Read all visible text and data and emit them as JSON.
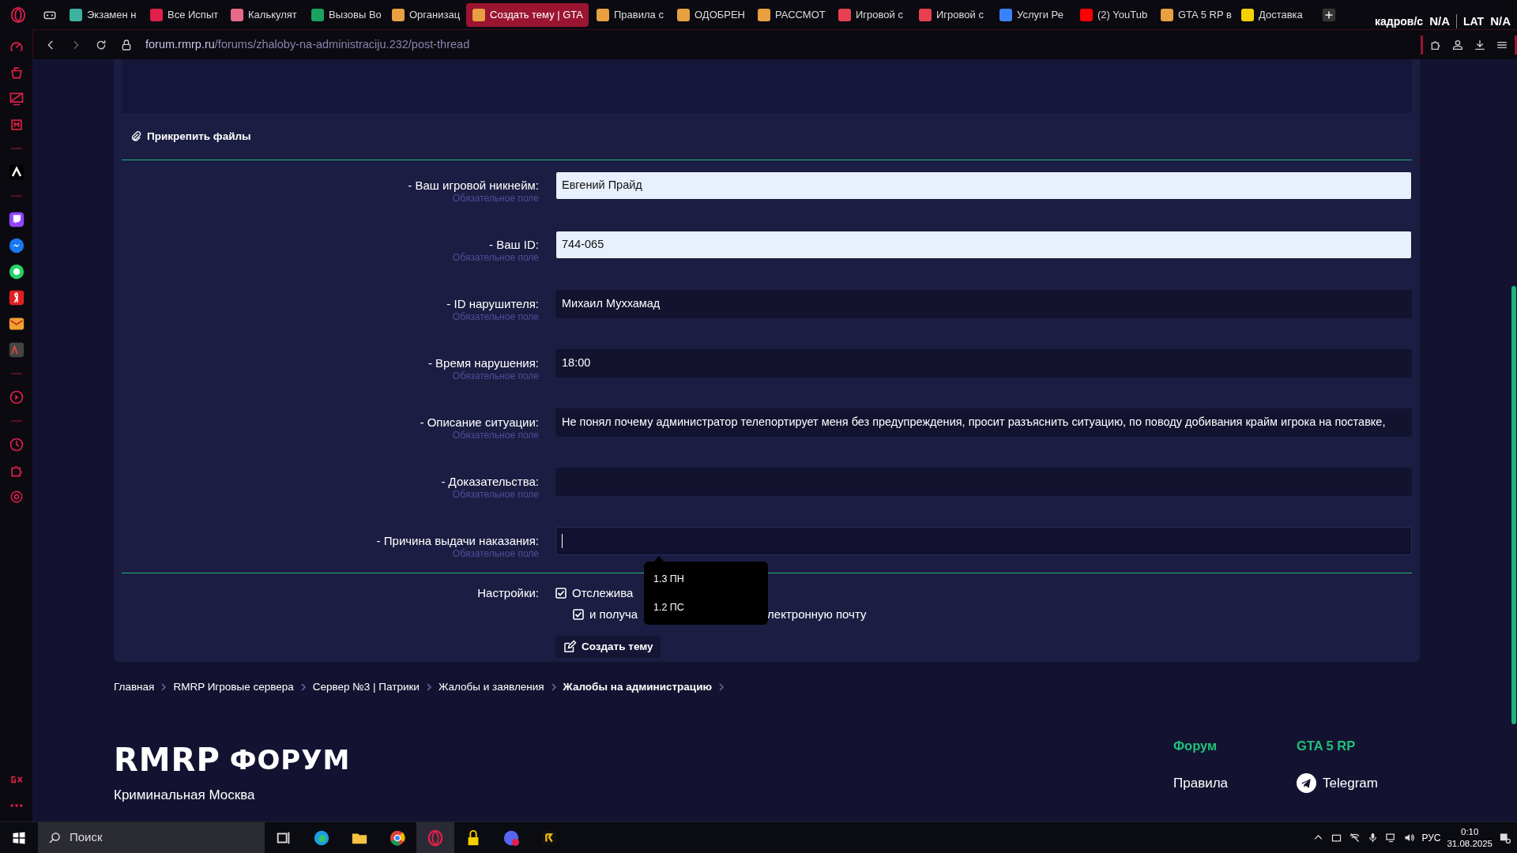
{
  "tabs": [
    {
      "label": "Экзамен н",
      "selected": false,
      "color": "#3bb3a0"
    },
    {
      "label": "Все Испыт",
      "selected": false,
      "color": "#e0204a"
    },
    {
      "label": "Калькулят",
      "selected": false,
      "color": "#e86a8a"
    },
    {
      "label": "Вызовы Во",
      "selected": false,
      "color": "#1aa260"
    },
    {
      "label": "Организац",
      "selected": false,
      "color": "#e8a040"
    },
    {
      "label": "Создать тему | GTA",
      "selected": true,
      "color": "#e8a040"
    },
    {
      "label": "Правила с",
      "selected": false,
      "color": "#e8a040"
    },
    {
      "label": "ОДОБРЕН",
      "selected": false,
      "color": "#e8a040"
    },
    {
      "label": "РАССМОТ",
      "selected": false,
      "color": "#e8a040"
    },
    {
      "label": "Игровой с",
      "selected": false,
      "color": "#e84050"
    },
    {
      "label": "Игровой с",
      "selected": false,
      "color": "#e84050"
    },
    {
      "label": "Услуги Ре",
      "selected": false,
      "color": "#3b82f6"
    },
    {
      "label": "(2) YouTub",
      "selected": false,
      "color": "#ff0000"
    },
    {
      "label": "GTA 5 RP в",
      "selected": false,
      "color": "#e8a040"
    },
    {
      "label": "Доставка",
      "selected": false,
      "color": "#f5d000"
    }
  ],
  "overlay_stats": [
    {
      "label": "кадров/с",
      "value": "N/A"
    },
    {
      "label": "LAT",
      "value": "N/A"
    }
  ],
  "address_bar": {
    "host": "forum.rmrp.ru",
    "path": "/forums/zhaloby-na-administraciju.232/post-thread"
  },
  "attach_button": "Прикрепить файлы",
  "fields": [
    {
      "label": "- Ваш игровой никнейм:",
      "hint": "Обязательное поле",
      "value": "Евгений Прайд",
      "autofilled": true,
      "focused": false
    },
    {
      "label": "- Ваш ID:",
      "hint": "Обязательное поле",
      "value": "744-065",
      "autofilled": true,
      "focused": false
    },
    {
      "label": "- ID нарушителя:",
      "hint": "Обязательное поле",
      "value": "Михаил Муххамад",
      "autofilled": false,
      "focused": false
    },
    {
      "label": "- Время нарушения:",
      "hint": "Обязательное поле",
      "value": "18:00",
      "autofilled": false,
      "focused": false
    },
    {
      "label": "- Описание ситуации:",
      "hint": "Обязательное поле",
      "value": "Не понял почему администратор телепортирует меня без предупреждения, просит разъяснить ситуацию, по поводу добивания крайм игрока на поставке,",
      "autofilled": false,
      "focused": false
    },
    {
      "label": "- Доказательства:",
      "hint": "Обязательное поле",
      "autofilled": false,
      "focused": false
    },
    {
      "label": "- Причина выдачи наказания:",
      "hint": "Обязательное поле",
      "autofilled": false,
      "focused": true
    }
  ],
  "autocomplete": [
    "1.3 ПН",
    "1.2 ПС"
  ],
  "settings": {
    "label": "Настройки:",
    "options": [
      {
        "label": "Отслежива",
        "checked": true
      },
      {
        "label": "и получа",
        "label_end": "лектронную почту",
        "checked": true
      }
    ]
  },
  "submit_button": "Создать тему",
  "breadcrumbs": [
    {
      "label": "Главная",
      "current": false
    },
    {
      "label": "RMRP Игровые сервера",
      "current": false
    },
    {
      "label": "Сервер №3 | Патрики",
      "current": false
    },
    {
      "label": "Жалобы и заявления",
      "current": false
    },
    {
      "label": "Жалобы на администрацию",
      "current": true
    }
  ],
  "footer": {
    "logo_left": "RMRP",
    "logo_right": "ФОРУМ",
    "tagline": "Криминальная Москва",
    "columns": [
      {
        "heading": "Форум",
        "items": [
          {
            "label": "Правила",
            "kind": "text"
          }
        ]
      },
      {
        "heading": "GTA 5 RP",
        "items": [
          {
            "label": "Telegram",
            "kind": "telegram"
          }
        ]
      }
    ]
  },
  "taskbar": {
    "search_placeholder": "Поиск",
    "language": "РУС",
    "time": "0:10",
    "date": "31.08.2025"
  }
}
